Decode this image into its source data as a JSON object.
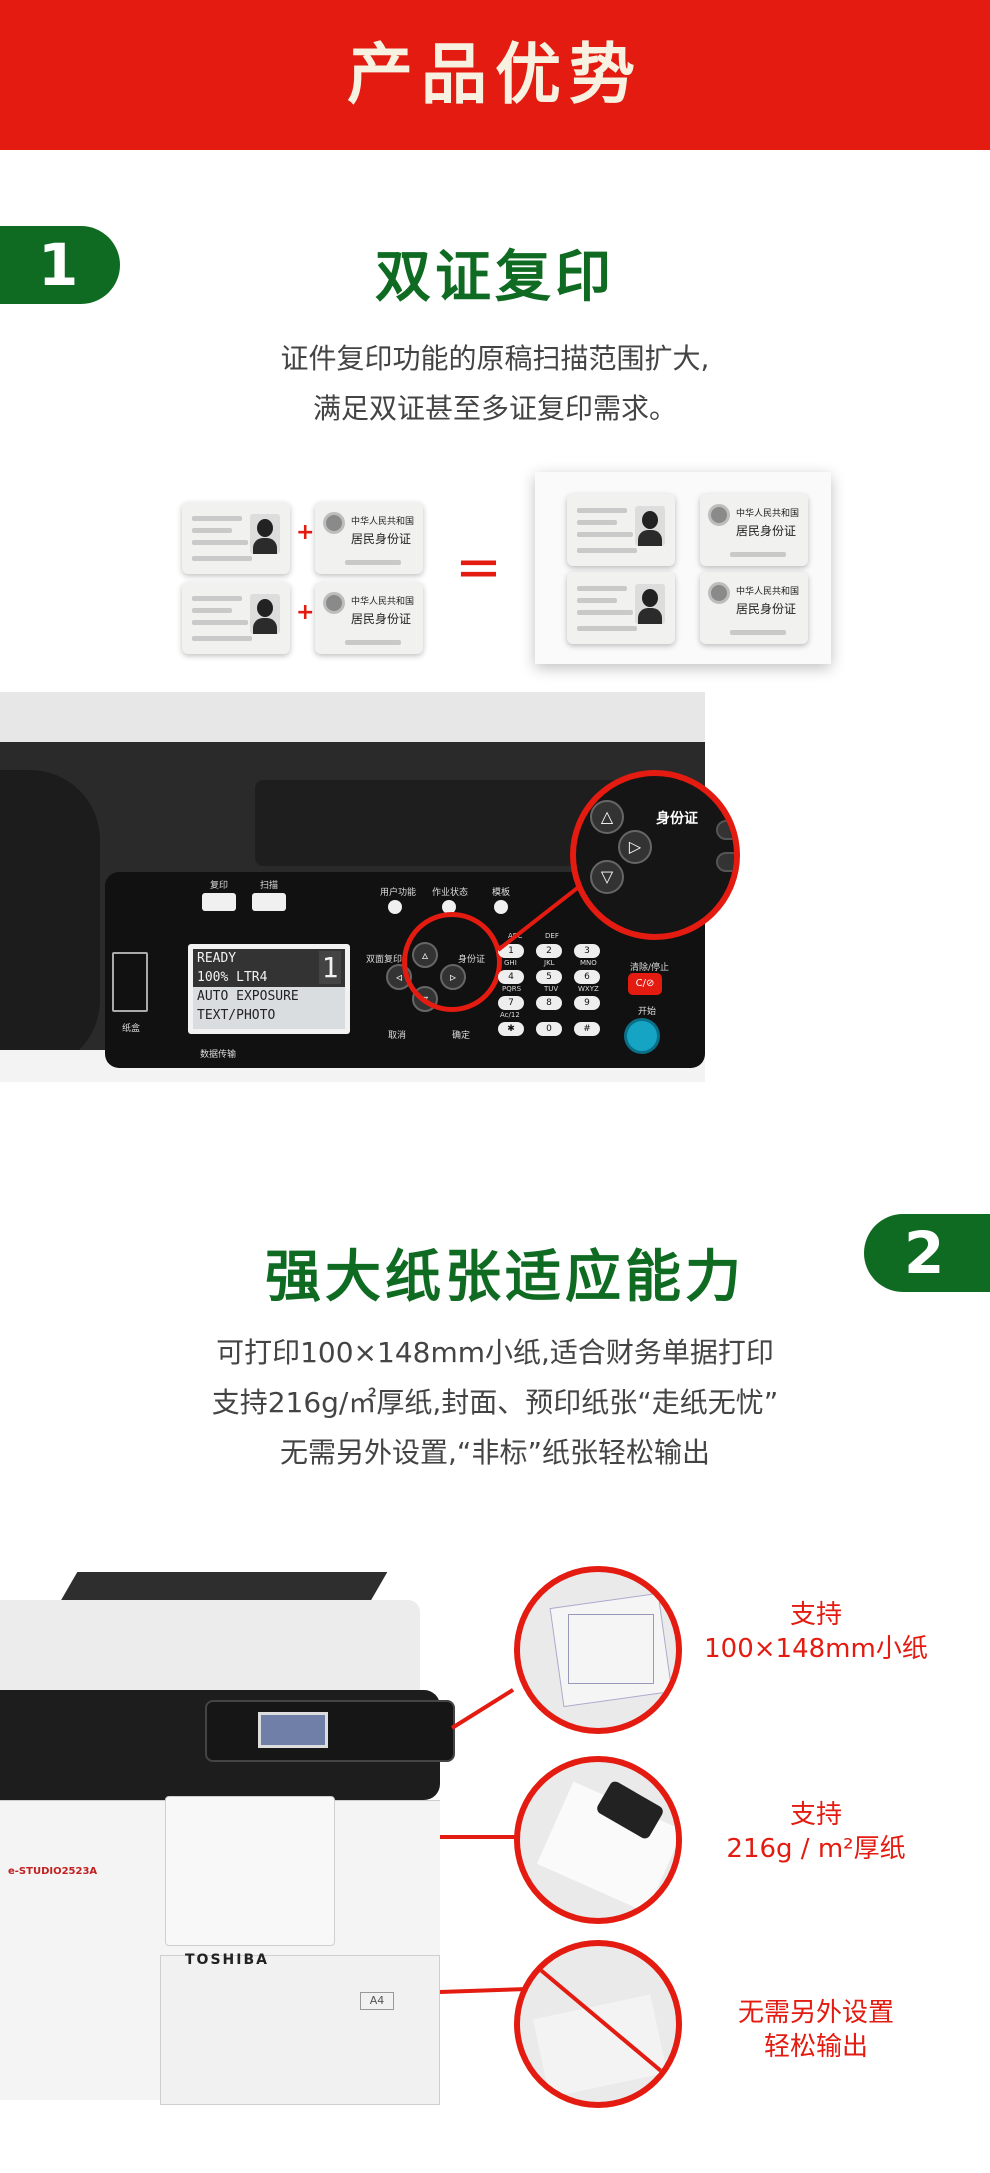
{
  "header": {
    "title": "产品优势"
  },
  "section1": {
    "number": "1",
    "title": "双证复印",
    "desc": [
      "证件复印功能的原稿扫描范围扩大,",
      "满足双证甚至多证复印需求。"
    ],
    "card_text": {
      "line1": "中华人民共和国",
      "line2": "居民身份证"
    }
  },
  "panel": {
    "copy": "复印",
    "scan": "扫描",
    "user_func": "用户功能",
    "job_status": "作业状态",
    "template": "模板",
    "dual_copy": "双面复印",
    "id_copy": "身份证",
    "id_copy_zoom": "身份证",
    "clear_stop": "清除/停止",
    "cs_key": "C/⊘",
    "start": "开始",
    "cancel": "取消",
    "confirm": "确定",
    "paper": "纸盒",
    "data": "数据传输",
    "lcd": [
      "READY",
      "100% LTR4",
      "AUTO EXPOSURE",
      "TEXT/PHOTO"
    ],
    "lcd_count": "1",
    "keys": [
      "1",
      "2",
      "3",
      "4",
      "5",
      "6",
      "7",
      "8",
      "9",
      "✱",
      "0",
      "#"
    ],
    "key_labels": [
      "ABC",
      "DEF",
      "GHI",
      "JKL",
      "MNO",
      "PQRS",
      "TUV",
      "WXYZ",
      "Ac/12"
    ]
  },
  "section2": {
    "number": "2",
    "title": "强大纸张适应能力",
    "desc": [
      "可打印100×148mm小纸,适合财务单据打印",
      "支持216g/㎡厚纸,封面、预印纸张“走纸无忧”",
      "无需另外设置,“非标”纸张轻松输出"
    ],
    "features": [
      {
        "line1": "支持",
        "line2": "100×148mm小纸"
      },
      {
        "line1": "支持",
        "line2": "216g / m²厚纸"
      },
      {
        "line1": "无需另外设置",
        "line2": "轻松输出"
      }
    ],
    "printer_brand": "TOSHIBA",
    "printer_model": "e-STUDIO2523A",
    "tray_label": "A4"
  }
}
